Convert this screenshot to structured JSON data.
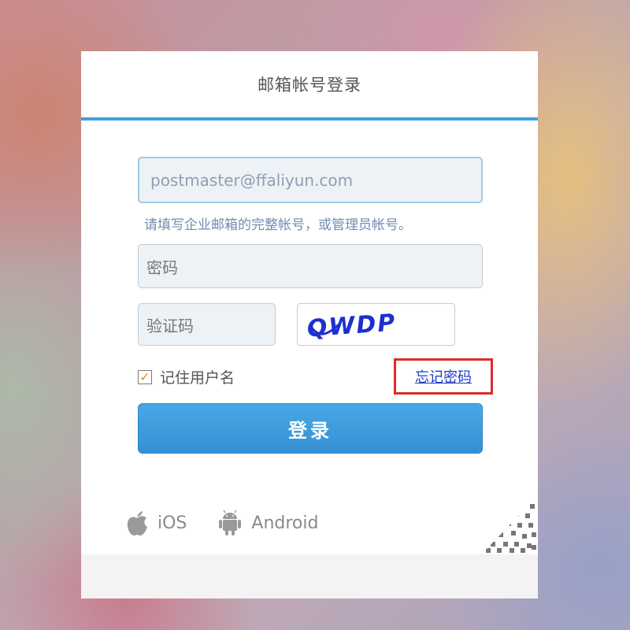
{
  "header": {
    "title": "邮箱帐号登录"
  },
  "form": {
    "email_value": "postmaster@ffaliyun.com",
    "email_hint": "请填写企业邮箱的完整帐号，或管理员帐号。",
    "password_placeholder": "密码",
    "captcha_placeholder": "验证码",
    "captcha_text": "QWDP",
    "remember_label": "记住用户名",
    "remember_checked": true,
    "forgot_label": "忘记密码",
    "login_label": "登录"
  },
  "apps": [
    {
      "label": "iOS",
      "icon": "apple-icon"
    },
    {
      "label": "Android",
      "icon": "android-icon"
    }
  ],
  "colors": {
    "accent": "#3ea0e4",
    "highlight": "#e02a2a",
    "link": "#1a3cc9"
  }
}
